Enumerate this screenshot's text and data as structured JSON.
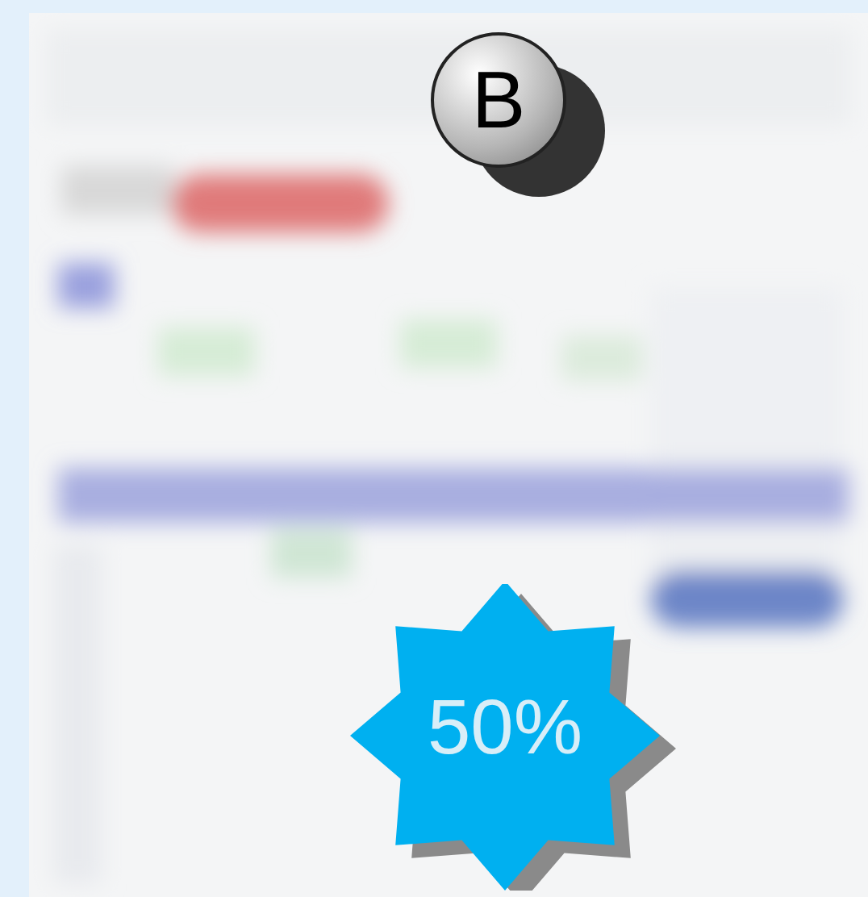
{
  "badge": {
    "letter": "B"
  },
  "discount": {
    "label": "50%"
  }
}
